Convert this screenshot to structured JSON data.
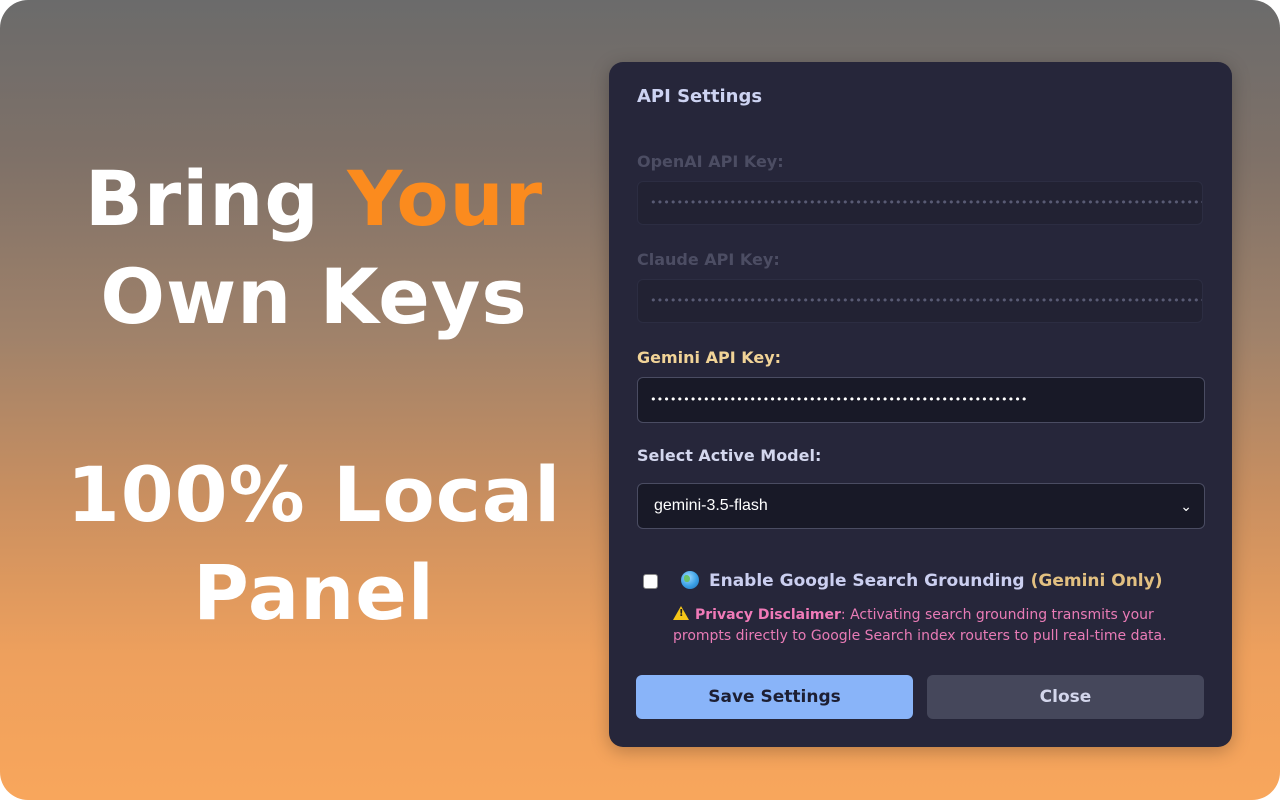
{
  "promo": {
    "line1_word1": "Bring ",
    "line1_accent": "Your",
    "line2": "Own Keys",
    "line3": "100% Local",
    "line4": "Panel"
  },
  "colors": {
    "accent": "#fb8b1e",
    "panel_bg": "#26263a",
    "save_button": "#89b4f9",
    "close_button": "#45475b",
    "disclaimer": "#e97bb6"
  },
  "panel": {
    "title": "API Settings",
    "openai": {
      "label": "OpenAI API Key:",
      "value": "••••••••••••••••••••••••••••••••••••••••••••••••••••••••••••••••••••••••••••••••••••••••••••••••••••••"
    },
    "claude": {
      "label": "Claude API Key:",
      "value": "••••••••••••••••••••••••••••••••••••••••••••••••••••••••••••••••••••••••••••••••••••••••••••••••••••••"
    },
    "gemini": {
      "label": "Gemini API Key:",
      "value": "•••••••••••••••••••••••••••••••••••••••••••••••••••••••••"
    },
    "model": {
      "label": "Select Active Model:",
      "selected": "gemini-3.5-flash",
      "chevron_icon": "chevron-down-icon"
    },
    "grounding": {
      "checked": false,
      "icon": "globe-icon",
      "label": "Enable Google Search Grounding",
      "note": "(Gemini Only)"
    },
    "disclaimer": {
      "icon": "warning-icon",
      "title": "Privacy Disclaimer",
      "text": ": Activating search grounding transmits your prompts directly to Google Search index routers to pull real-time data."
    },
    "buttons": {
      "save": "Save Settings",
      "close": "Close"
    }
  }
}
